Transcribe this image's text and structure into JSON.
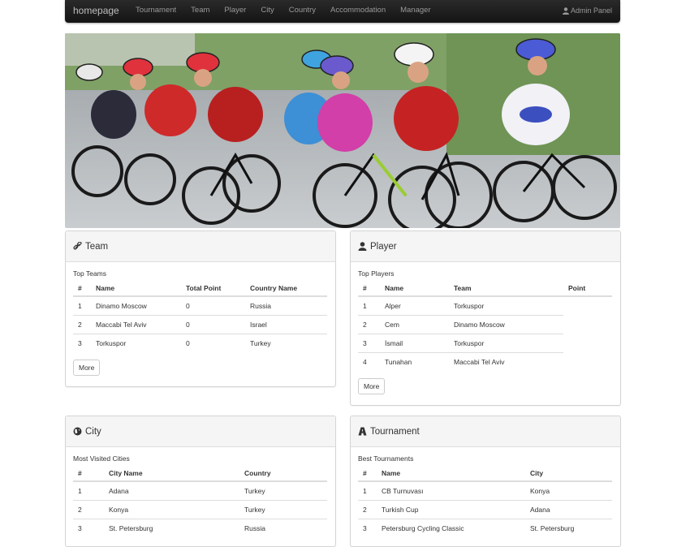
{
  "navbar": {
    "brand": "homepage",
    "items": [
      "Tournament",
      "Team",
      "Player",
      "City",
      "Country",
      "Accommodation",
      "Manager"
    ],
    "admin_label": "Admin Panel"
  },
  "team_panel": {
    "title": "Team",
    "caption": "Top Teams",
    "columns": [
      "#",
      "Name",
      "Total Point",
      "Country Name"
    ],
    "rows": [
      [
        "1",
        "Dinamo Moscow",
        "0",
        "Russia"
      ],
      [
        "2",
        "Maccabi Tel Aviv",
        "0",
        "Israel"
      ],
      [
        "3",
        "Torkuspor",
        "0",
        "Turkey"
      ]
    ],
    "more_label": "More"
  },
  "player_panel": {
    "title": "Player",
    "caption": "Top Players",
    "columns": [
      "#",
      "Name",
      "Team",
      "Point"
    ],
    "rows": [
      [
        "1",
        "Alper",
        "Torkuspor"
      ],
      [
        "2",
        "Cem",
        "Dinamo Moscow"
      ],
      [
        "3",
        "İsmail",
        "Torkuspor"
      ],
      [
        "4",
        "Tunahan",
        "Maccabi Tel Aviv"
      ]
    ],
    "more_label": "More"
  },
  "city_panel": {
    "title": "City",
    "caption": "Most Visited Cities",
    "columns": [
      "#",
      "City Name",
      "Country"
    ],
    "rows": [
      [
        "1",
        "Adana",
        "Turkey"
      ],
      [
        "2",
        "Konya",
        "Turkey"
      ],
      [
        "3",
        "St. Petersburg",
        "Russia"
      ]
    ]
  },
  "tournament_panel": {
    "title": "Tournament",
    "caption": "Best Tournaments",
    "columns": [
      "#",
      "Name",
      "City"
    ],
    "rows": [
      [
        "1",
        "CB Turnuvası",
        "Konya"
      ],
      [
        "2",
        "Turkish Cup",
        "Adana"
      ],
      [
        "3",
        "Petersburg Cycling Classic",
        "St. Petersburg"
      ]
    ]
  },
  "colors": {
    "navbar_bg": "#1f1f1f",
    "panel_heading_bg": "#f5f5f5",
    "border": "#dddddd"
  },
  "icons": {
    "team": "link-icon",
    "player": "user-icon",
    "city": "globe-icon",
    "tournament": "road-icon",
    "admin": "user-icon"
  }
}
